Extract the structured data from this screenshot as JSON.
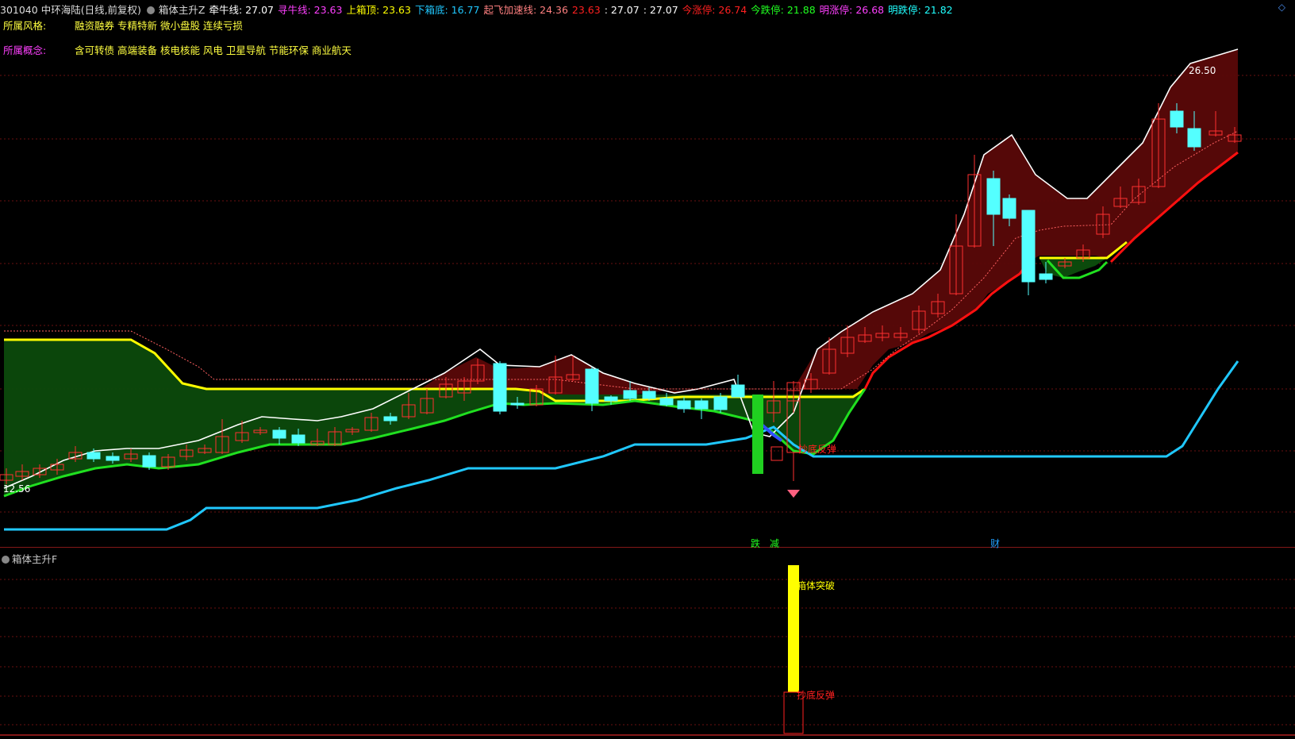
{
  "header": {
    "symbol": "301040 中环海陆(日线,前复权)",
    "indicator_name": "箱体主升Z",
    "fields": [
      {
        "label": "牵牛线: ",
        "value": "27.07",
        "color": "#ffffff"
      },
      {
        "label": "寻牛线: ",
        "value": "23.63",
        "color": "#ff40ff"
      },
      {
        "label": "上箱顶: ",
        "value": "23.63",
        "color": "#ffff00"
      },
      {
        "label": "下箱底: ",
        "value": "16.77",
        "color": "#20c8ff"
      },
      {
        "label": "起飞加速线: ",
        "value": "24.36",
        "color": "#ff8080"
      },
      {
        "label": "",
        "value": "23.63",
        "color": "#ff2020"
      },
      {
        "label": "",
        "value": ": 27.07",
        "color": "#ffffff"
      },
      {
        "label": "",
        "value": ": 27.07",
        "color": "#ffffff"
      },
      {
        "label": "今涨停: ",
        "value": "26.74",
        "color": "#ff2020"
      },
      {
        "label": "今跌停: ",
        "value": "21.88",
        "color": "#20ff20"
      },
      {
        "label": "明涨停: ",
        "value": "26.68",
        "color": "#ff40ff"
      },
      {
        "label": "明跌停: ",
        "value": "21.82",
        "color": "#20ffff"
      }
    ],
    "corner_icon": "diamond-icon"
  },
  "info": {
    "style_label": "所属风格:",
    "style_value": "融资融券 专精特新 微小盘股 连续亏损",
    "concept_label": "所属概念:",
    "concept_value": "含可转债 高端装备 核电核能 风电 卫星导航 节能环保 商业航天"
  },
  "main_chart": {
    "peak_label": "26.50",
    "low_label": "12.56",
    "signal_label": "抄底反弹",
    "bottom_markers": [
      {
        "text": "跌",
        "color": "#20ff20"
      },
      {
        "text": "减",
        "color": "#20ff20"
      },
      {
        "text": "财",
        "color": "#20a0ff"
      }
    ]
  },
  "sub_chart": {
    "title": "箱体主升F",
    "breakout_label": "箱体突破",
    "rebound_label": "抄底反弹"
  },
  "colors": {
    "up": "#ff3030",
    "down": "#54ffff",
    "box_top": "#ffff00",
    "box_bottom": "#20c8ff",
    "green_fill": "#0c4a0c",
    "red_fill": "#5a0808"
  }
}
